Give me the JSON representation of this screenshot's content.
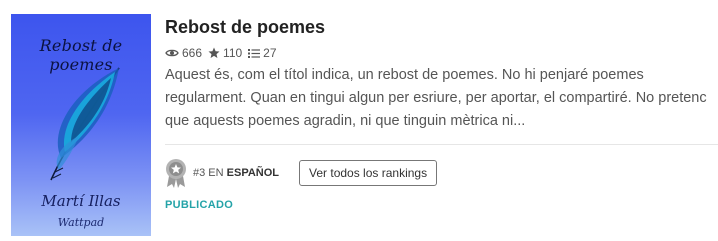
{
  "story": {
    "title": "Rebost de poemes",
    "cover": {
      "title": "Rebost de poemes",
      "author": "Martí Illas",
      "publisher": "Wattpad"
    },
    "stats": {
      "reads": "666",
      "votes": "110",
      "parts": "27"
    },
    "description": "Aquest és, com el títol indica, un rebost de poemes. No hi penjaré poemes regularment. Quan en tingui algun per esriure, per aportar, el compartiré. No pretenc que aquests poemes agradin, ni que tinguin mètrica ni...",
    "ranking": {
      "position": "#3",
      "connector": " EN ",
      "category": "ESPAÑOL",
      "button_label": "Ver todos los rankings"
    },
    "status": "PUBLICADO"
  },
  "icons": {
    "reads": "eye-icon",
    "votes": "star-icon",
    "parts": "list-icon",
    "ranking": "medal-icon"
  },
  "colors": {
    "status": "#24a3a8",
    "cover_top": "#3d55ee",
    "cover_bottom": "#a9c2f7"
  }
}
